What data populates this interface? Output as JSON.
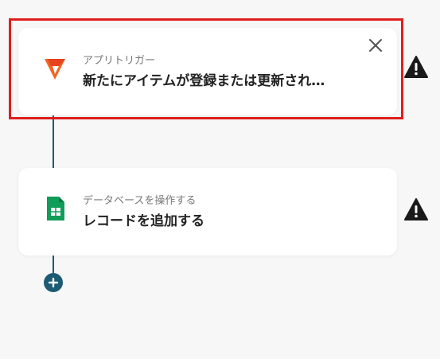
{
  "flow": {
    "steps": [
      {
        "category": "アプリトリガー",
        "title": "新たにアイテムが登録または更新され…",
        "icon": "app-logo-icon",
        "selected": true
      },
      {
        "category": "データベースを操作する",
        "title": "レコードを追加する",
        "icon": "google-sheets-icon",
        "selected": false
      }
    ],
    "warning_icon": "warning-icon",
    "add_icon": "add-step-icon"
  },
  "colors": {
    "accent": "#1d5a73",
    "highlight": "#e01e1e",
    "brand_orange": "#f26522",
    "sheets_green": "#0f9d58",
    "warning": "#1a1a1a"
  }
}
